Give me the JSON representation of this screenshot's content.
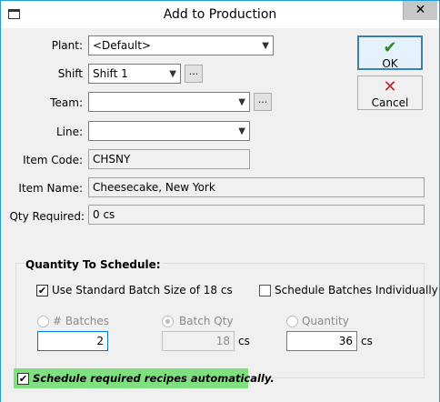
{
  "window": {
    "title": "Add to Production",
    "close_glyph": "✕"
  },
  "fields": {
    "plant": {
      "label": "Plant:",
      "value": "<Default>"
    },
    "shift": {
      "label": "Shift",
      "value": "Shift 1",
      "browse": "..."
    },
    "team": {
      "label": "Team:",
      "value": "",
      "browse": "..."
    },
    "line": {
      "label": "Line:",
      "value": ""
    },
    "item_code": {
      "label": "Item Code:",
      "value": "CHSNY"
    },
    "item_name": {
      "label": "Item Name:",
      "value": "Cheesecake, New York"
    },
    "qty_required": {
      "label": "Qty Required:",
      "value": "0 cs"
    }
  },
  "buttons": {
    "ok": {
      "label": "OK",
      "glyph": "✔"
    },
    "cancel": {
      "label": "Cancel",
      "glyph": "✕"
    }
  },
  "schedule": {
    "title": "Quantity To Schedule:",
    "use_standard": {
      "label": "Use Standard Batch Size of 18 cs",
      "checked": true
    },
    "individually": {
      "label": "Schedule Batches Individually",
      "checked": false
    },
    "batches": {
      "label": "# Batches",
      "value": "2"
    },
    "batch_qty": {
      "label": "Batch Qty",
      "value": "18",
      "unit": "cs"
    },
    "quantity": {
      "label": "Quantity",
      "value": "36",
      "unit": "cs"
    }
  },
  "auto": {
    "label": "Schedule required recipes automatically.",
    "checked": true
  },
  "colors": {
    "accent": "#1e9fd6",
    "ok_green": "#2e8b2e",
    "cancel_red": "#c0282d",
    "highlight": "#7fe07f"
  }
}
